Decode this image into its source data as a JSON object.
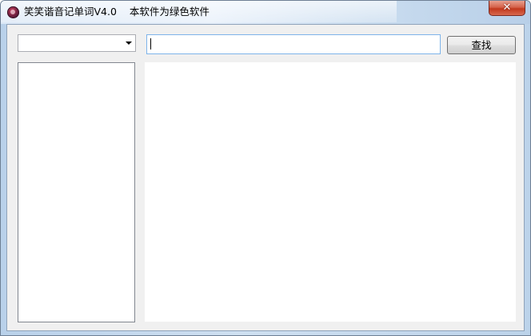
{
  "window": {
    "title": "笑笑谐音记单词V4.0    本软件为绿色软件",
    "close_glyph": "✕"
  },
  "toolbar": {
    "combo_value": "",
    "search_value": "",
    "find_label": "查找"
  },
  "icons": {
    "app": "app-icon",
    "close": "close-icon",
    "dropdown": "chevron-down-icon"
  },
  "colors": {
    "close_button": "#c2391d",
    "input_focus_border": "#7eb4ea",
    "client_background": "#f0f0f0"
  }
}
